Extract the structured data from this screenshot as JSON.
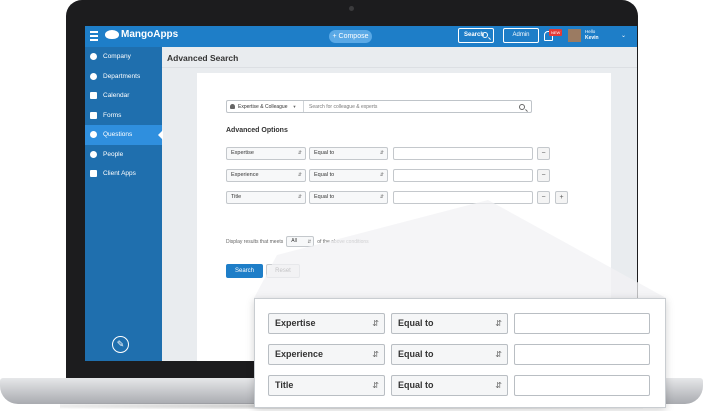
{
  "app": {
    "logo_text": "MangoApps",
    "compose_label": "+ Compose",
    "search_label": "Search",
    "admin_label": "Admin",
    "notification_badge": "NEW",
    "user_greeting": "Hello",
    "user_name": "Kevin"
  },
  "sidebar": {
    "items": [
      {
        "label": "Company",
        "icon": "globe-icon"
      },
      {
        "label": "Departments",
        "icon": "pie-icon"
      },
      {
        "label": "Calendar",
        "icon": "calendar-icon"
      },
      {
        "label": "Forms",
        "icon": "forms-icon"
      },
      {
        "label": "Questions",
        "icon": "question-icon",
        "active": true
      },
      {
        "label": "People",
        "icon": "person-icon"
      },
      {
        "label": "Client Apps",
        "icon": "download-icon"
      }
    ],
    "edit_icon": "pencil-icon"
  },
  "page": {
    "title": "Advanced Search",
    "scope_select": "Expertise & Colleague",
    "search_placeholder": "Search for colleague & experts",
    "advanced_heading": "Advanced Options",
    "criteria": [
      {
        "field": "Expertise",
        "operator": "Equal to",
        "value": ""
      },
      {
        "field": "Experience",
        "operator": "Equal to",
        "value": ""
      },
      {
        "field": "Title",
        "operator": "Equal to",
        "value": ""
      }
    ],
    "remove_label": "−",
    "add_label": "+",
    "meets_prefix": "Display results that meets",
    "meets_value": "All",
    "meets_suffix": "of the above conditions",
    "search_button": "Search",
    "reset_button": "Reset"
  },
  "callout": {
    "criteria": [
      {
        "field": "Expertise",
        "operator": "Equal to",
        "value": ""
      },
      {
        "field": "Experience",
        "operator": "Equal to",
        "value": ""
      },
      {
        "field": "Title",
        "operator": "Equal to",
        "value": ""
      }
    ]
  },
  "colors": {
    "header_blue": "#1e7ec8",
    "sidebar_blue": "#1f6fae",
    "active_blue": "#2f8fde"
  }
}
